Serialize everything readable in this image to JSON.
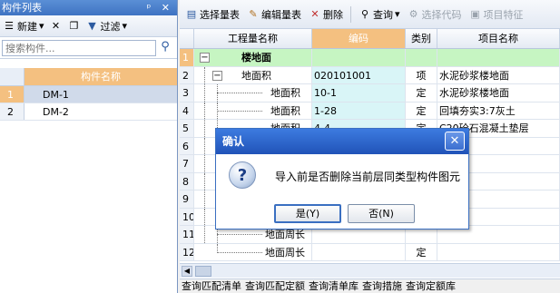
{
  "left_panel": {
    "title": "构件列表",
    "title_controls": "ᵖ ▾ ✕",
    "toolbar": {
      "new_label": "新建",
      "filter_label": "过滤"
    },
    "search_placeholder": "搜索构件...",
    "column_header": "构件名称",
    "rows": [
      {
        "num": "1",
        "name": "DM-1"
      },
      {
        "num": "2",
        "name": "DM-2"
      }
    ]
  },
  "right_panel": {
    "toolbar": {
      "select_list": "选择量表",
      "edit_list": "编辑量表",
      "delete": "删除",
      "query": "查询",
      "select_code": "选择代码",
      "item_features": "项目特征"
    },
    "columns": [
      "工程量名称",
      "编码",
      "类别",
      "项目名称"
    ],
    "rows": [
      {
        "num": "1",
        "name": "楼地面",
        "code": "",
        "type": "",
        "project": ""
      },
      {
        "num": "2",
        "name": "地面积",
        "code": "020101001",
        "type": "项",
        "project": "水泥砂浆楼地面"
      },
      {
        "num": "3",
        "name": "地面积",
        "code": "10-1",
        "type": "定",
        "project": "水泥砂浆楼地面"
      },
      {
        "num": "4",
        "name": "地面积",
        "code": "1-28",
        "type": "定",
        "project": "回填夯实3:7灰土"
      },
      {
        "num": "5",
        "name": "地面积",
        "code": "4-4",
        "type": "定",
        "project": "C20砼石混凝土垫层"
      },
      {
        "num": "6",
        "name": "",
        "code": "",
        "type": "",
        "project": ""
      },
      {
        "num": "7",
        "name": "",
        "code": "",
        "type": "",
        "project": ""
      },
      {
        "num": "8",
        "name": "",
        "code": "",
        "type": "",
        "project": ""
      },
      {
        "num": "9",
        "name": "",
        "code": "",
        "type": "",
        "project": ""
      },
      {
        "num": "10",
        "name": "",
        "code": "",
        "type": "",
        "project": ""
      },
      {
        "num": "11",
        "name": "地面周长",
        "code": "",
        "type": "",
        "project": ""
      },
      {
        "num": "12",
        "name": "地面周长",
        "code": "",
        "type": "定",
        "project": ""
      }
    ],
    "bottom_tabs": [
      "查询匹配清单",
      "查询匹配定额",
      "查询清单库",
      "查询措施",
      "查询定额库"
    ]
  },
  "dialog": {
    "title": "确认",
    "message": "导入前是否删除当前层同类型构件图元",
    "yes_label": "是(Y)",
    "no_label": "否(N)"
  }
}
